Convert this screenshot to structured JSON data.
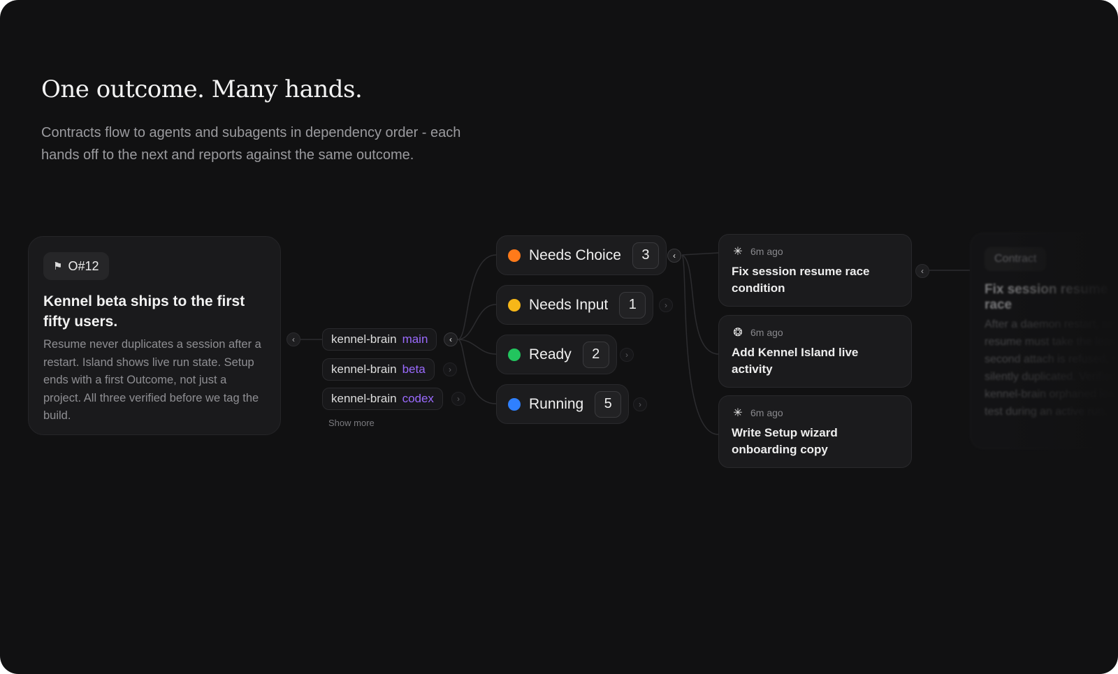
{
  "hero": {
    "title": "One outcome. Many hands.",
    "subtitle": "Contracts flow to agents and subagents in dependency order - each hands off to the next and reports against the same outcome."
  },
  "outcome": {
    "icon": "flag-icon",
    "id": "O#12",
    "title": "Kennel beta ships to the first fifty users.",
    "description": "Resume never duplicates a session after a restart. Island shows live run state. Setup ends with a first Outcome, not just a project. All three verified before we tag the build."
  },
  "branches": {
    "items": [
      {
        "repo": "kennel-brain",
        "tag": "main",
        "active": true
      },
      {
        "repo": "kennel-brain",
        "tag": "beta",
        "active": false
      },
      {
        "repo": "kennel-brain",
        "tag": "codex",
        "active": false
      }
    ],
    "show_more": "Show more",
    "tag_color": "#9b6bff"
  },
  "statuses": {
    "items": [
      {
        "label": "Needs Choice",
        "count": "3",
        "color": "#ff7a1a",
        "active": true
      },
      {
        "label": "Needs Input",
        "count": "1",
        "color": "#f7b718",
        "active": false
      },
      {
        "label": "Ready",
        "count": "2",
        "color": "#22c55e",
        "active": false
      },
      {
        "label": "Running",
        "count": "5",
        "color": "#2f80ff",
        "active": false
      }
    ]
  },
  "tasks": {
    "items": [
      {
        "icon": "sparkle-icon",
        "time": "6m ago",
        "title": "Fix session resume race condition"
      },
      {
        "icon": "openai-icon",
        "time": "6m ago",
        "title": "Add Kennel Island live activity"
      },
      {
        "icon": "sparkle-icon",
        "time": "6m ago",
        "title": "Write Setup wizard onboarding copy"
      }
    ]
  },
  "contract": {
    "tag": "Contract",
    "title": "Fix session resume race",
    "description": "After a daemon restart, session resume must take the lease. A second attach is refused, not silently duplicated. Verified by: kennel-brain orphaned lease test during an active run."
  }
}
